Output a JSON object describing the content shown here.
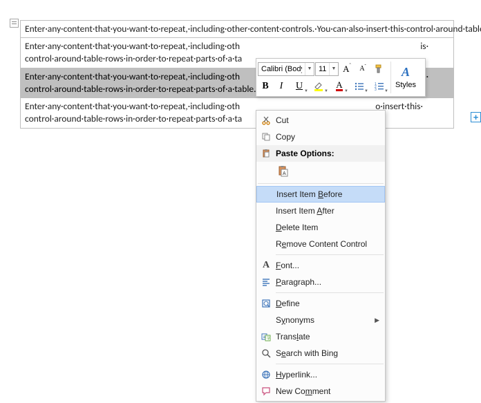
{
  "content": {
    "paragraph": "Enter·any·content·that·you·want·to·repeat,·including·other·content·controls.·You·can·also·insert·this·control·around·table·rows·in·order·to·repeat·parts·of·a·table.¶",
    "para_line1_left": "Enter·any·content·that·you·want·to·repeat,·including·oth",
    "para_line1_right_a": "is·",
    "para_line1_right_b": "o·insert·this·",
    "para_line2": "control·around·table·rows·in·order·to·repeat·parts·of·a·ta",
    "para_line2_hl": "control·around·table·rows·in·order·to·repeat·parts·of·a·table.",
    "pilcrow": "¶"
  },
  "mini_toolbar": {
    "font_name": "Calibri (Body)",
    "font_size": "11",
    "bold": "B",
    "italic": "I",
    "underline": "U",
    "grow": "A",
    "shrink": "A",
    "styles": "Styles"
  },
  "ctx": {
    "cut": "Cut",
    "copy": "Copy",
    "paste_options": "Paste Options:",
    "insert_before": "Insert Item Before",
    "insert_after": "Insert Item After",
    "delete_item": "Delete Item",
    "remove_cc": "Remove Content Control",
    "font": "Font...",
    "paragraph": "Paragraph...",
    "define": "Define",
    "synonyms": "Synonyms",
    "translate": "Translate",
    "search_bing": "Search with Bing",
    "hyperlink": "Hyperlink...",
    "new_comment": "New Comment"
  }
}
